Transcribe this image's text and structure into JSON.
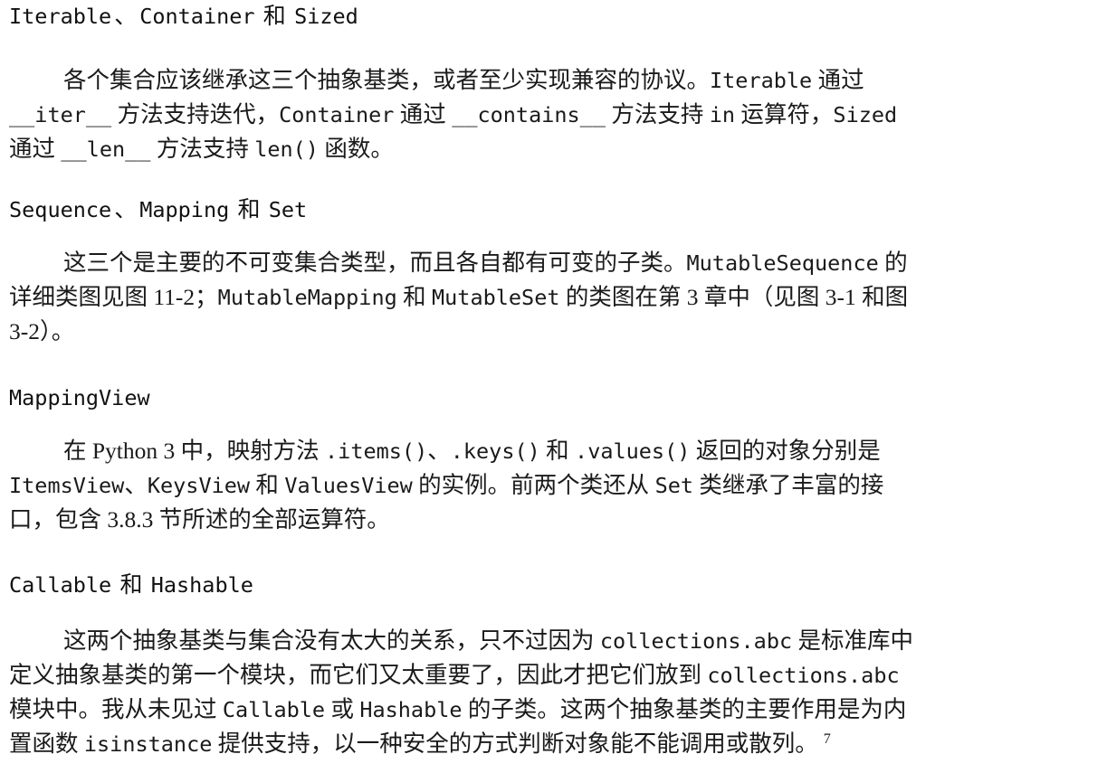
{
  "document": {
    "kind": "book-page",
    "language": "zh-CN",
    "background_color": "#ffffff",
    "text_color": "#000000"
  },
  "sections": [
    {
      "id": "iterable-container-sized",
      "heading": {
        "parts": [
          {
            "type": "code",
            "text": "Iterable"
          },
          {
            "type": "cjk",
            "text": "、"
          },
          {
            "type": "code",
            "text": "Container"
          },
          {
            "type": "cjk",
            "text": " 和 "
          },
          {
            "type": "code",
            "text": "Sized"
          }
        ],
        "plain": "Iterable、Container 和 Sized"
      },
      "paragraph": {
        "plain": "各个集合应该继承这三个抽象基类，或者至少实现兼容的协议。Iterable 通过 __iter__ 方法支持迭代，Container 通过 __contains__ 方法支持 in 运算符，Sized 通过 __len__ 方法支持 len() 函数。",
        "lines": [
          [
            {
              "type": "indent",
              "text": ""
            },
            {
              "type": "cjk",
              "text": "各个集合应该继承这三个抽象基类，或者至少实现兼容的协议。"
            },
            {
              "type": "code",
              "text": "Iterable"
            },
            {
              "type": "cjk",
              "text": " 通过"
            }
          ],
          [
            {
              "type": "code",
              "text": "__iter__"
            },
            {
              "type": "cjk",
              "text": " 方法支持迭代，"
            },
            {
              "type": "code",
              "text": "Container"
            },
            {
              "type": "cjk",
              "text": " 通过 "
            },
            {
              "type": "code",
              "text": "__contains__"
            },
            {
              "type": "cjk",
              "text": " 方法支持 "
            },
            {
              "type": "code",
              "text": "in"
            },
            {
              "type": "cjk",
              "text": " 运算符，"
            },
            {
              "type": "code",
              "text": "Sized"
            }
          ],
          [
            {
              "type": "cjk",
              "text": "通过 "
            },
            {
              "type": "code",
              "text": "__len__"
            },
            {
              "type": "cjk",
              "text": " 方法支持 "
            },
            {
              "type": "code",
              "text": "len()"
            },
            {
              "type": "cjk",
              "text": " 函数。"
            }
          ]
        ]
      }
    },
    {
      "id": "sequence-mapping-set",
      "heading": {
        "parts": [
          {
            "type": "code",
            "text": "Sequence"
          },
          {
            "type": "cjk",
            "text": "、"
          },
          {
            "type": "code",
            "text": "Mapping"
          },
          {
            "type": "cjk",
            "text": " 和 "
          },
          {
            "type": "code",
            "text": "Set"
          }
        ],
        "plain": "Sequence、Mapping 和 Set"
      },
      "paragraph": {
        "plain": "这三个是主要的不可变集合类型，而且各自都有可变的子类。MutableSequence 的详细类图见图 11-2；MutableMapping 和 MutableSet 的类图在第 3 章中（见图 3-1 和图 3-2）。",
        "lines": [
          [
            {
              "type": "indent",
              "text": ""
            },
            {
              "type": "cjk",
              "text": "这三个是主要的不可变集合类型，而且各自都有可变的子类。"
            },
            {
              "type": "code",
              "text": "MutableSequence"
            },
            {
              "type": "cjk",
              "text": " 的"
            }
          ],
          [
            {
              "type": "cjk",
              "text": "详细类图见图 11-2；"
            },
            {
              "type": "code",
              "text": "MutableMapping"
            },
            {
              "type": "cjk",
              "text": " 和 "
            },
            {
              "type": "code",
              "text": "MutableSet"
            },
            {
              "type": "cjk",
              "text": " 的类图在第 3 章中（见图 3-1 和图"
            }
          ],
          [
            {
              "type": "cjk",
              "text": "3-2）。"
            }
          ]
        ]
      }
    },
    {
      "id": "mappingview",
      "heading": {
        "parts": [
          {
            "type": "code",
            "text": "MappingView"
          }
        ],
        "plain": "MappingView"
      },
      "paragraph": {
        "plain": "在 Python 3 中，映射方法 .items()、.keys() 和 .values() 返回的对象分别是 ItemsView、KeysView 和 ValuesView 的实例。前两个类还从 Set 类继承了丰富的接口，包含 3.8.3 节所述的全部运算符。",
        "lines": [
          [
            {
              "type": "indent",
              "text": ""
            },
            {
              "type": "cjk",
              "text": "在 Python 3 中，映射方法 "
            },
            {
              "type": "code",
              "text": ".items()"
            },
            {
              "type": "cjk",
              "text": "、"
            },
            {
              "type": "code",
              "text": ".keys()"
            },
            {
              "type": "cjk",
              "text": " 和 "
            },
            {
              "type": "code",
              "text": ".values()"
            },
            {
              "type": "cjk",
              "text": " 返回的对象分别是"
            }
          ],
          [
            {
              "type": "code",
              "text": "ItemsView"
            },
            {
              "type": "cjk",
              "text": "、"
            },
            {
              "type": "code",
              "text": "KeysView"
            },
            {
              "type": "cjk",
              "text": " 和 "
            },
            {
              "type": "code",
              "text": "ValuesView"
            },
            {
              "type": "cjk",
              "text": " 的实例。前两个类还从 "
            },
            {
              "type": "code",
              "text": "Set"
            },
            {
              "type": "cjk",
              "text": " 类继承了丰富的接"
            }
          ],
          [
            {
              "type": "cjk",
              "text": "口，包含 3.8.3 节所述的全部运算符。"
            }
          ]
        ]
      }
    },
    {
      "id": "callable-hashable",
      "heading": {
        "parts": [
          {
            "type": "code",
            "text": "Callable"
          },
          {
            "type": "cjk",
            "text": " 和 "
          },
          {
            "type": "code",
            "text": "Hashable"
          }
        ],
        "plain": "Callable 和 Hashable"
      },
      "paragraph": {
        "plain": "这两个抽象基类与集合没有太大的关系，只不过因为 collections.abc 是标准库中定义抽象基类的第一个模块，而它们又太重要了，因此才把它们放到 collections.abc 模块中。我从未见过 Callable 或 Hashable 的子类。这两个抽象基类的主要作用是为内置函数 isinstance 提供支持，以一种安全的方式判断对象能不能调用或散列。7",
        "footnote_marker": "7",
        "lines": [
          [
            {
              "type": "indent",
              "text": ""
            },
            {
              "type": "cjk",
              "text": "这两个抽象基类与集合没有太大的关系，只不过因为 "
            },
            {
              "type": "code",
              "text": "collections.abc"
            },
            {
              "type": "cjk",
              "text": " 是标准库中"
            }
          ],
          [
            {
              "type": "cjk",
              "text": "定义抽象基类的第一个模块，而它们又太重要了，因此才把它们放到 "
            },
            {
              "type": "code",
              "text": "collections.abc"
            }
          ],
          [
            {
              "type": "cjk",
              "text": "模块中。我从未见过 "
            },
            {
              "type": "code",
              "text": "Callable"
            },
            {
              "type": "cjk",
              "text": " 或 "
            },
            {
              "type": "code",
              "text": "Hashable"
            },
            {
              "type": "cjk",
              "text": " 的子类。这两个抽象基类的主要作用是为内"
            }
          ],
          [
            {
              "type": "cjk",
              "text": "置函数 "
            },
            {
              "type": "code",
              "text": "isinstance"
            },
            {
              "type": "cjk",
              "text": " 提供支持，以一种安全的方式判断对象能不能调用或散列。"
            },
            {
              "type": "sup",
              "text": "7"
            }
          ]
        ]
      }
    }
  ]
}
